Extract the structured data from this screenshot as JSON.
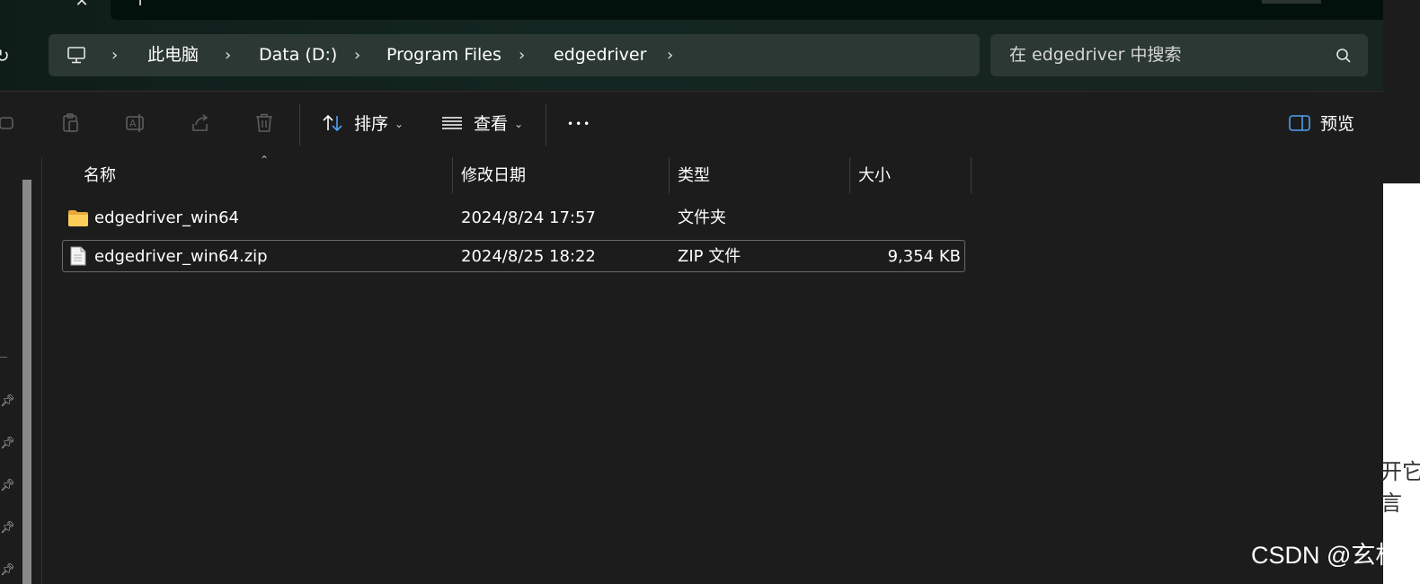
{
  "tab": {
    "close_icon": "✕"
  },
  "nav": {
    "refresh_icon": "↻",
    "breadcrumb": [
      "此电脑",
      "Data (D:)",
      "Program Files",
      "edgedriver"
    ],
    "separator": "›"
  },
  "search": {
    "placeholder": "在 edgedriver 中搜索",
    "icon": "search-icon"
  },
  "toolbar": {
    "sort_label": "排序",
    "view_label": "查看",
    "more_label": "•••",
    "preview_label": "预览",
    "caret": "⌄"
  },
  "columns": {
    "name": "名称",
    "modified": "修改日期",
    "type": "类型",
    "size": "大小",
    "sort_indicator": "⌃"
  },
  "files": [
    {
      "name": "edgedriver_win64",
      "modified": "2024/8/24 17:57",
      "type": "文件夹",
      "size": "",
      "icon": "folder-icon"
    },
    {
      "name": "edgedriver_win64.zip",
      "modified": "2024/8/25 18:22",
      "type": "ZIP 文件",
      "size": "9,354 KB",
      "icon": "zip-file-icon"
    }
  ],
  "background_page": {
    "line1": "开它",
    "line2": "言"
  },
  "watermark": "CSDN @玄相"
}
